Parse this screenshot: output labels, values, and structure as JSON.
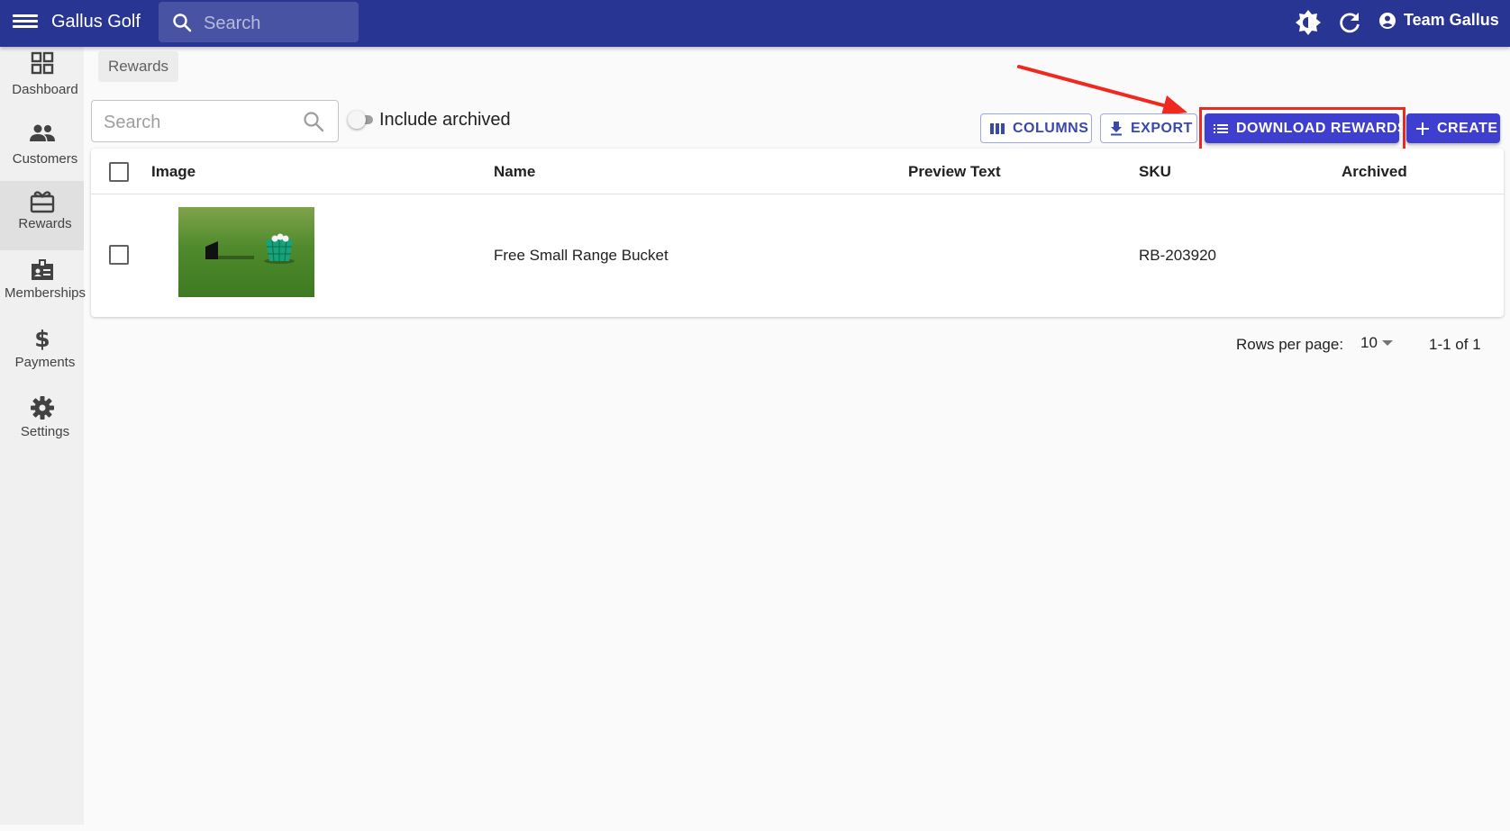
{
  "app": {
    "title": "Gallus Golf",
    "search_placeholder": "Search",
    "user_name": "Team Gallus"
  },
  "sidebar": {
    "items": [
      {
        "label": "Dashboard",
        "icon": "dashboard-icon"
      },
      {
        "label": "Customers",
        "icon": "people-icon"
      },
      {
        "label": "Rewards",
        "icon": "card-giftcard-icon",
        "active": true
      },
      {
        "label": "Memberships",
        "icon": "badge-icon"
      },
      {
        "label": "Payments",
        "icon": "dollar-icon"
      },
      {
        "label": "Settings",
        "icon": "gear-icon"
      }
    ]
  },
  "breadcrumb": "Rewards",
  "filters": {
    "search_placeholder": "Search",
    "include_archived_label": "Include archived",
    "include_archived": false
  },
  "toolbar": {
    "columns_label": "COLUMNS",
    "export_label": "EXPORT",
    "download_label": "DOWNLOAD REWARDS",
    "create_label": "CREATE"
  },
  "table": {
    "columns": [
      "Image",
      "Name",
      "Preview Text",
      "SKU",
      "Archived"
    ],
    "rows": [
      {
        "name": "Free Small Range Bucket",
        "preview_text": "",
        "sku": "RB-203920",
        "archived": ""
      }
    ]
  },
  "pagination": {
    "rows_per_page_label": "Rows per page:",
    "rows_per_page": "10",
    "range": "1-1 of 1"
  },
  "colors": {
    "appbar": "#283593",
    "primary": "#3f3fcf",
    "highlight": "#f0281e"
  }
}
